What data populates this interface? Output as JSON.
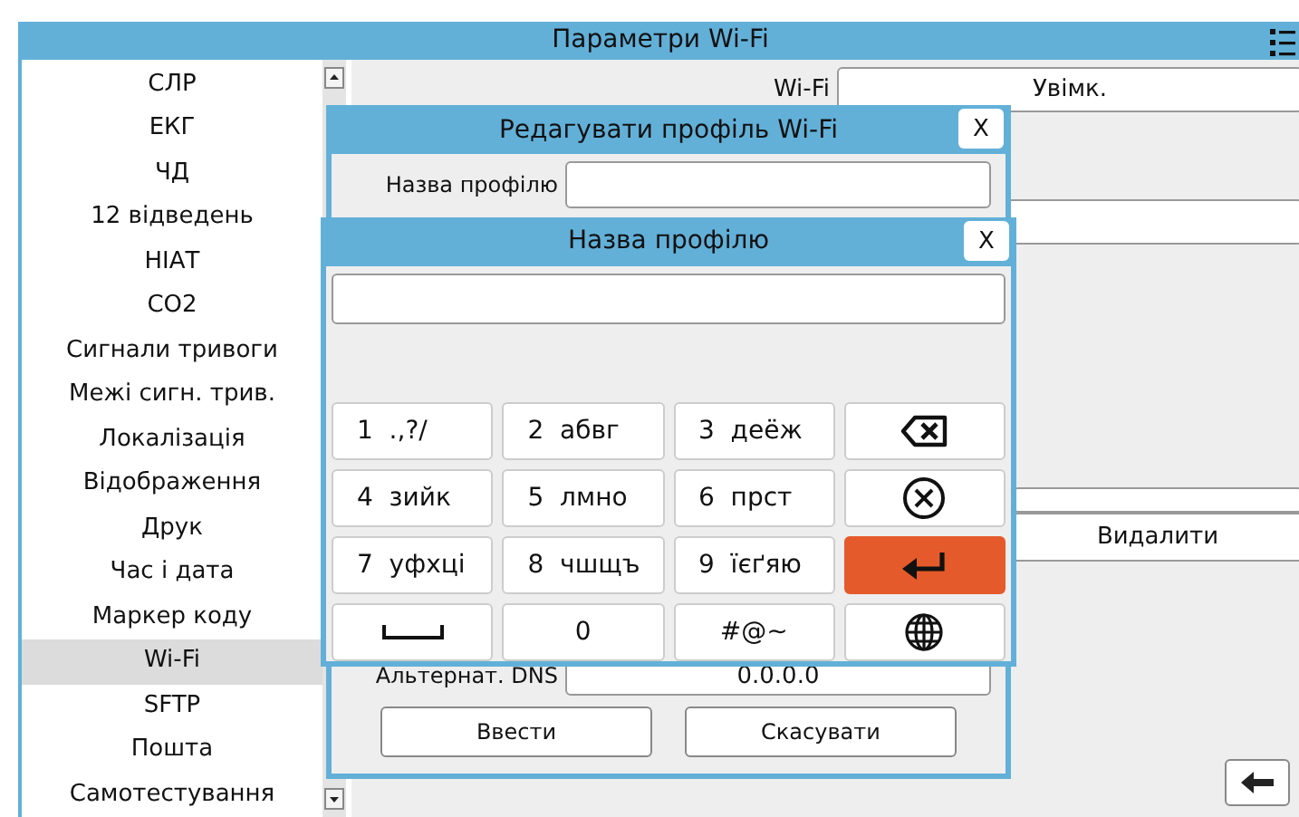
{
  "window": {
    "title": "Параметри Wi-Fi"
  },
  "sidebar": {
    "items": [
      {
        "label": "СЛР",
        "selected": false
      },
      {
        "label": "ЕКГ",
        "selected": false
      },
      {
        "label": "ЧД",
        "selected": false
      },
      {
        "label": "12 відведень",
        "selected": false
      },
      {
        "label": "НІАТ",
        "selected": false
      },
      {
        "label": "CO2",
        "selected": false
      },
      {
        "label": "Сигнали тривоги",
        "selected": false
      },
      {
        "label": "Межі сигн. трив.",
        "selected": false
      },
      {
        "label": "Локалізація",
        "selected": false
      },
      {
        "label": "Відображення",
        "selected": false
      },
      {
        "label": "Друк",
        "selected": false
      },
      {
        "label": "Час і дата",
        "selected": false
      },
      {
        "label": "Маркер коду",
        "selected": false
      },
      {
        "label": "Wi-Fi",
        "selected": true
      },
      {
        "label": "SFTP",
        "selected": false
      },
      {
        "label": "Пошта",
        "selected": false
      },
      {
        "label": "Самотестування",
        "selected": false
      }
    ]
  },
  "settings": {
    "wifi_label": "Wi-Fi",
    "wifi_value": "Увімк.",
    "delete_button": "Видалити"
  },
  "edit_dialog": {
    "title": "Редагувати профіль Wi-Fi",
    "close": "X",
    "profile_name_label": "Назва профілю",
    "alt_dns_label": "Альтернат. DNS",
    "alt_dns_value": "0.0.0.0",
    "buttons": [
      "Ввести",
      "Скасувати"
    ]
  },
  "keypad_dialog": {
    "title": "Назва профілю",
    "close": "X",
    "keys": [
      {
        "kind": "text",
        "digit": "1",
        "letters": ".,?/"
      },
      {
        "kind": "text",
        "digit": "2",
        "letters": "абвг"
      },
      {
        "kind": "text",
        "digit": "3",
        "letters": "деёж"
      },
      {
        "kind": "backspace"
      },
      {
        "kind": "text",
        "digit": "4",
        "letters": "зийк"
      },
      {
        "kind": "text",
        "digit": "5",
        "letters": "лмно"
      },
      {
        "kind": "text",
        "digit": "6",
        "letters": "прст"
      },
      {
        "kind": "clear"
      },
      {
        "kind": "text",
        "digit": "7",
        "letters": "уфхці"
      },
      {
        "kind": "text",
        "digit": "8",
        "letters": "чшщъ"
      },
      {
        "kind": "text",
        "digit": "9",
        "letters": "їєґяю"
      },
      {
        "kind": "enter"
      },
      {
        "kind": "space"
      },
      {
        "kind": "symbol",
        "label": "0"
      },
      {
        "kind": "symbol",
        "label": "#@~"
      },
      {
        "kind": "language"
      }
    ]
  }
}
